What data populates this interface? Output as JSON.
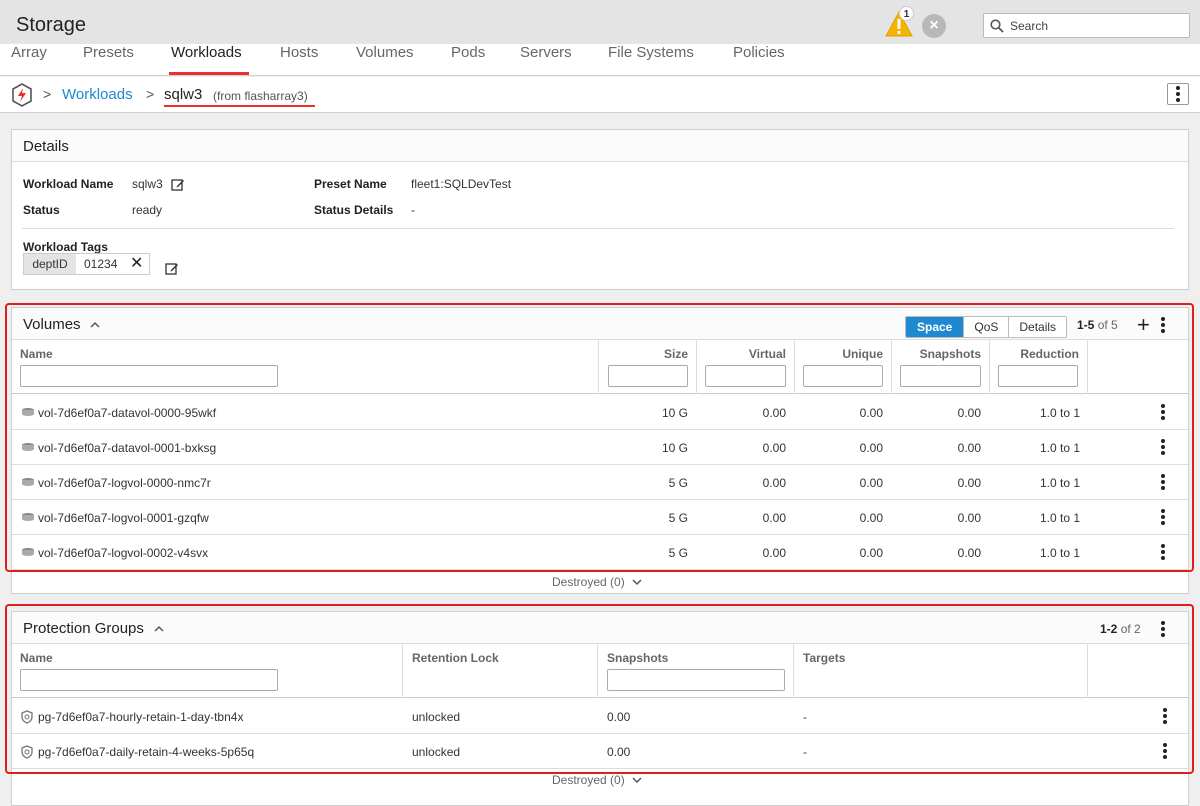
{
  "header": {
    "title": "Storage",
    "alert_count": "1",
    "search_placeholder": "Search"
  },
  "nav": {
    "tabs": [
      "Array",
      "Presets",
      "Workloads",
      "Hosts",
      "Volumes",
      "Pods",
      "Servers",
      "File Systems",
      "Policies"
    ],
    "active": "Workloads"
  },
  "breadcrumb": {
    "sep": ">",
    "parent": "Workloads",
    "current": "sqlw3",
    "source": "(from flasharray3)"
  },
  "details": {
    "title": "Details",
    "workload_name_label": "Workload Name",
    "workload_name": "sqlw3",
    "status_label": "Status",
    "status": "ready",
    "preset_name_label": "Preset Name",
    "preset_name": "fleet1:SQLDevTest",
    "status_details_label": "Status Details",
    "status_details": "-",
    "tags_label": "Workload Tags",
    "tag_key": "deptID",
    "tag_value": "01234",
    "tag_remove": "✕"
  },
  "volumes": {
    "title": "Volumes",
    "view_buttons": [
      "Space",
      "QoS",
      "Details"
    ],
    "pager_range": "1-5",
    "pager_of": "of 5",
    "add_symbol": "+",
    "columns": [
      "Name",
      "Size",
      "Virtual",
      "Unique",
      "Snapshots",
      "Reduction"
    ],
    "rows": [
      {
        "name": "vol-7d6ef0a7-datavol-0000-95wkf",
        "size": "10 G",
        "virtual": "0.00",
        "unique": "0.00",
        "snapshots": "0.00",
        "reduction": "1.0 to 1"
      },
      {
        "name": "vol-7d6ef0a7-datavol-0001-bxksg",
        "size": "10 G",
        "virtual": "0.00",
        "unique": "0.00",
        "snapshots": "0.00",
        "reduction": "1.0 to 1"
      },
      {
        "name": "vol-7d6ef0a7-logvol-0000-nmc7r",
        "size": "5 G",
        "virtual": "0.00",
        "unique": "0.00",
        "snapshots": "0.00",
        "reduction": "1.0 to 1"
      },
      {
        "name": "vol-7d6ef0a7-logvol-0001-gzqfw",
        "size": "5 G",
        "virtual": "0.00",
        "unique": "0.00",
        "snapshots": "0.00",
        "reduction": "1.0 to 1"
      },
      {
        "name": "vol-7d6ef0a7-logvol-0002-v4svx",
        "size": "5 G",
        "virtual": "0.00",
        "unique": "0.00",
        "snapshots": "0.00",
        "reduction": "1.0 to 1"
      }
    ],
    "destroyed": "Destroyed (0)"
  },
  "protection_groups": {
    "title": "Protection Groups",
    "pager_range": "1-2",
    "pager_of": "of 2",
    "columns": [
      "Name",
      "Retention Lock",
      "Snapshots",
      "Targets"
    ],
    "rows": [
      {
        "name": "pg-7d6ef0a7-hourly-retain-1-day-tbn4x",
        "retention_lock": "unlocked",
        "snapshots": "0.00",
        "targets": "-"
      },
      {
        "name": "pg-7d6ef0a7-daily-retain-4-weeks-5p65q",
        "retention_lock": "unlocked",
        "snapshots": "0.00",
        "targets": "-"
      }
    ],
    "destroyed": "Destroyed (0)"
  },
  "colors": {
    "accent": "#1e88d0",
    "highlight": "#e01e1e",
    "warning": "#f5b400"
  }
}
